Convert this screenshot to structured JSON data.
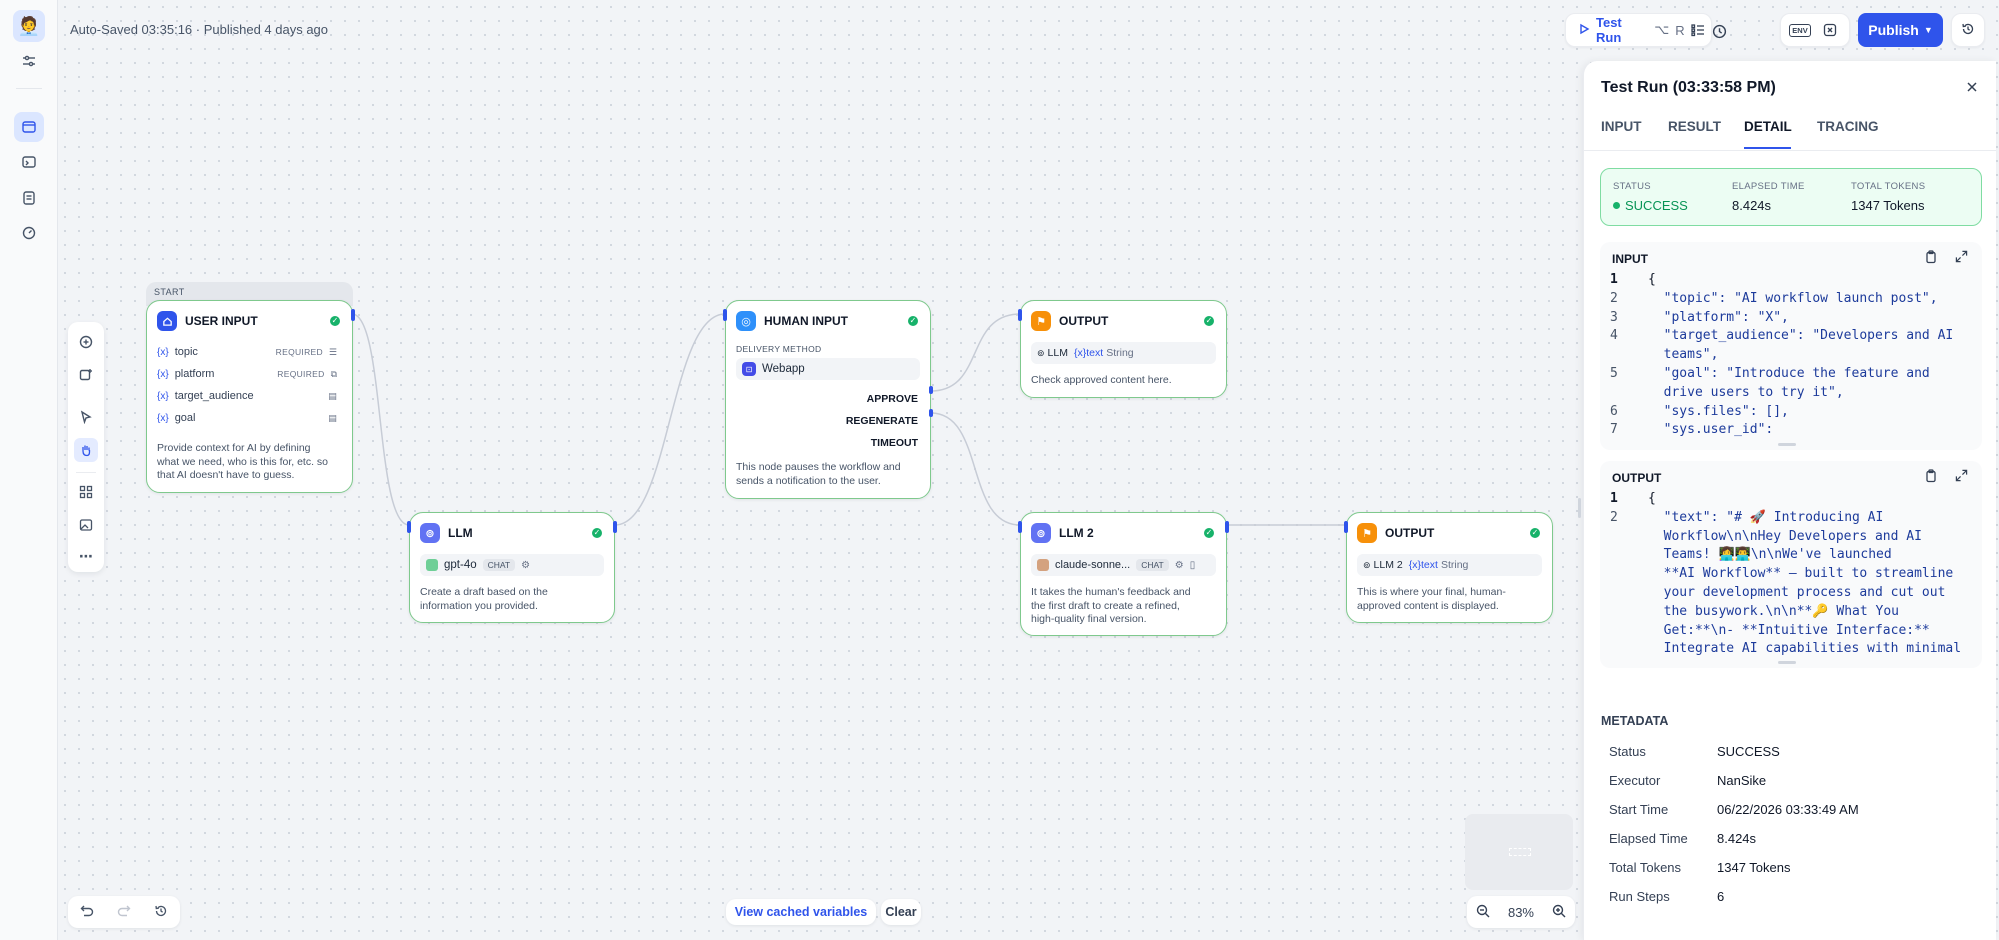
{
  "header": {
    "autosave": "Auto-Saved 03:35:16 · Published 4 days ago",
    "test_run_label": "Test Run",
    "shortcut_alt": "⌥",
    "shortcut_key": "R",
    "env_label": "ENV",
    "publish_label": "Publish"
  },
  "nodes": {
    "start_label": "START",
    "user_input": {
      "title": "USER INPUT",
      "variables": [
        {
          "name": "topic",
          "required": "REQUIRED"
        },
        {
          "name": "platform",
          "required": "REQUIRED"
        },
        {
          "name": "target_audience",
          "required": ""
        },
        {
          "name": "goal",
          "required": ""
        }
      ],
      "var_prefix": "{x}",
      "desc_1": "Provide context for AI by defining",
      "desc_2": "what we need, who is this for, etc. so",
      "desc_3": "that AI doesn't have to guess."
    },
    "llm": {
      "title": "LLM",
      "model": "gpt-4o",
      "tag": "CHAT",
      "desc_1": "Create a draft based on the",
      "desc_2": "information you provided."
    },
    "human_input": {
      "title": "HUMAN INPUT",
      "delivery_label": "DELIVERY METHOD",
      "delivery_value": "Webapp",
      "actions": [
        "APPROVE",
        "REGENERATE",
        "TIMEOUT"
      ],
      "desc_1": "This node pauses the workflow and",
      "desc_2": "sends a notification to the user."
    },
    "output_1": {
      "title": "OUTPUT",
      "source": "LLM",
      "var": "{x}text",
      "type": "String",
      "desc": "Check approved content here."
    },
    "llm2": {
      "title": "LLM 2",
      "model": "claude-sonne...",
      "tag": "CHAT",
      "desc_1": "It takes the human's feedback and",
      "desc_2": "the first draft to create a refined,",
      "desc_3": "high-quality final version."
    },
    "output_2": {
      "title": "OUTPUT",
      "source": "LLM 2",
      "var": "{x}text",
      "type": "String",
      "desc_1": "This is where your final, human-",
      "desc_2": "approved content is displayed."
    }
  },
  "bottom": {
    "view_cached": "View cached variables",
    "clear": "Clear",
    "zoom": "83%"
  },
  "panel": {
    "title": "Test Run (03:33:58 PM)",
    "tabs": [
      "INPUT",
      "RESULT",
      "DETAIL",
      "TRACING"
    ],
    "active_tab": "DETAIL",
    "status": {
      "status_label": "STATUS",
      "status_value": "SUCCESS",
      "elapsed_label": "ELAPSED TIME",
      "elapsed_value": "8.424s",
      "tokens_label": "TOTAL TOKENS",
      "tokens_value": "1347 Tokens",
      "success_color": "#17b26a"
    },
    "input_block": {
      "title": "INPUT",
      "line_numbers": [
        "1",
        "2",
        "3",
        "4",
        "",
        "5",
        "",
        "6",
        "7"
      ],
      "lines": [
        "{",
        "  \"topic\": \"AI workflow launch post\",",
        "  \"platform\": \"X\",",
        "  \"target_audience\": \"Developers and AI",
        "  teams\",",
        "  \"goal\": \"Introduce the feature and",
        "  drive users to try it\",",
        "  \"sys.files\": [],",
        "  \"sys.user_id\":"
      ]
    },
    "output_block": {
      "title": "OUTPUT",
      "line_numbers": [
        "1",
        "2",
        "",
        "",
        "",
        "",
        "",
        "",
        ""
      ],
      "lines": [
        "{",
        "  \"text\": \"# 🚀 Introducing AI",
        "  Workflow\\n\\nHey Developers and AI",
        "  Teams! 👩‍💻👨‍💻\\n\\nWe've launched",
        "  **AI Workflow** — built to streamline",
        "  your development process and cut out",
        "  the busywork.\\n\\n**🔑 What You",
        "  Get:**\\n- **Intuitive Interface:**",
        "  Integrate AI capabilities with minimal"
      ]
    },
    "metadata": {
      "title": "METADATA",
      "rows": [
        {
          "label": "Status",
          "value": "SUCCESS"
        },
        {
          "label": "Executor",
          "value": "NanSike"
        },
        {
          "label": "Start Time",
          "value": "06/22/2026 03:33:49 AM"
        },
        {
          "label": "Elapsed Time",
          "value": "8.424s"
        },
        {
          "label": "Total Tokens",
          "value": "1347 Tokens"
        },
        {
          "label": "Run Steps",
          "value": "6"
        }
      ]
    }
  },
  "colors": {
    "accent": "#2f54eb",
    "node_border_success": "#7fc98d",
    "success": "#17b26a"
  }
}
